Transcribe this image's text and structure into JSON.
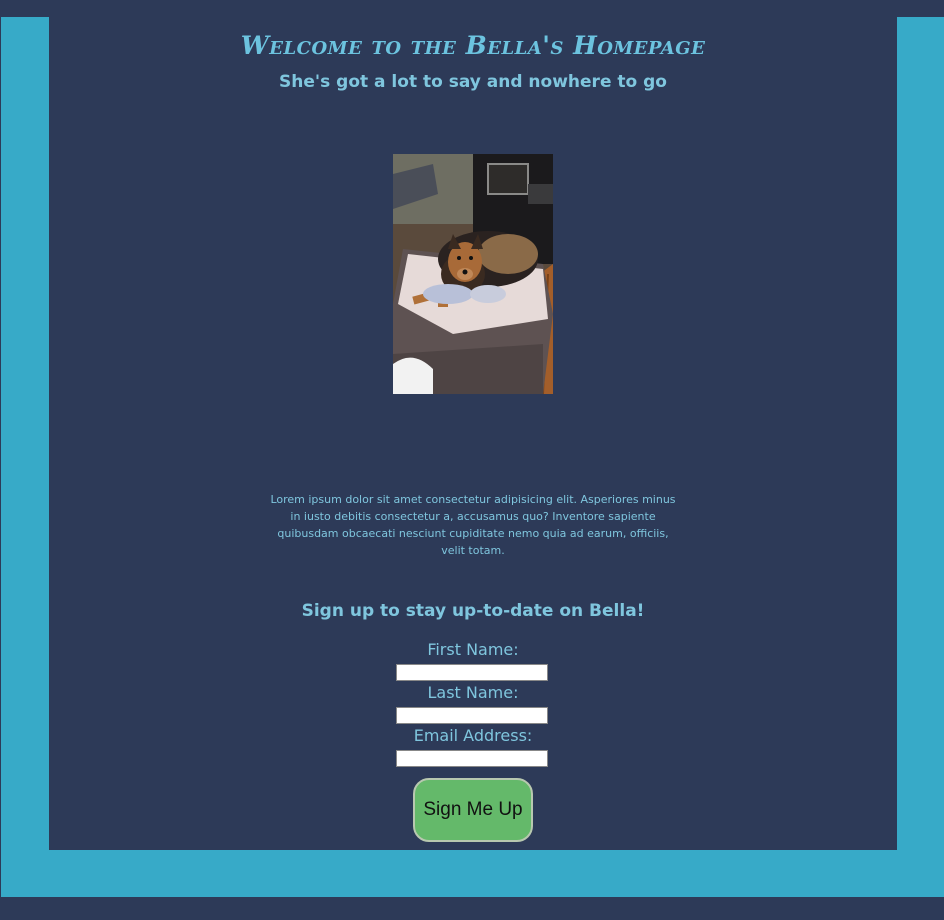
{
  "header": {
    "title": "Welcome to the Bella's Homepage",
    "subtitle": "She's got a lot to say and nowhere to go"
  },
  "photo": {
    "subject": "dog-lying-on-ottoman"
  },
  "intro_text": "Lorem ipsum dolor sit amet consectetur adipisicing elit. Asperiores minus in iusto debitis consectetur a, accusamus quo? Inventore sapiente quibusdam obcaecati nesciunt cupiditate nemo quia ad earum, officiis, velit totam.",
  "signup": {
    "title": "Sign up to stay up-to-date on Bella!",
    "first_name_label": "First Name:",
    "first_name_value": "",
    "last_name_label": "Last Name:",
    "last_name_value": "",
    "email_label": "Email Address:",
    "email_value": "",
    "submit_label": "Sign Me Up"
  },
  "colors": {
    "page_background": "#2d3a58",
    "frame": "#37aac8",
    "text": "#7fc6de",
    "button": "#64b96a"
  }
}
